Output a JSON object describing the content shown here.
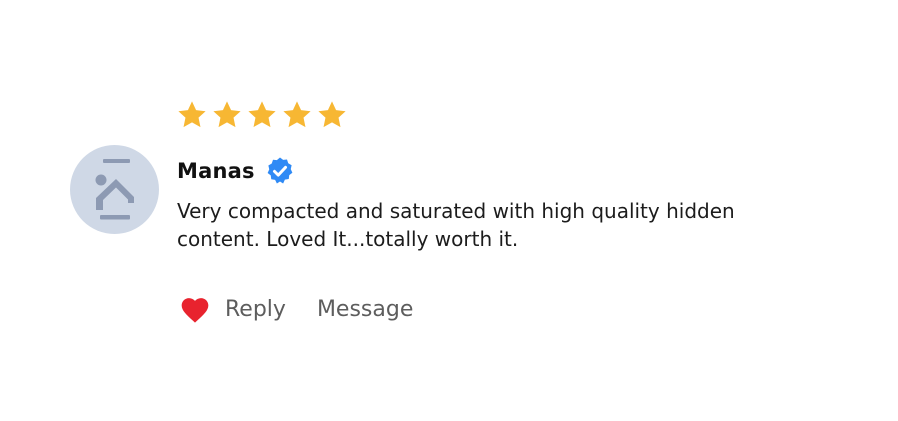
{
  "review": {
    "rating": 5,
    "rating_max": 5,
    "star_color": "#F7B733",
    "author": {
      "name": "Manas",
      "verified": true,
      "avatar_icon": "image-placeholder-icon",
      "verified_icon": "verified-badge-icon",
      "verified_color": "#2F8AF5"
    },
    "text": "Very compacted and saturated with high quality hidden content. Loved It...totally worth it.",
    "actions": {
      "like_icon": "heart-icon",
      "like_color": "#E8232E",
      "reply_label": "Reply",
      "message_label": "Message"
    }
  }
}
